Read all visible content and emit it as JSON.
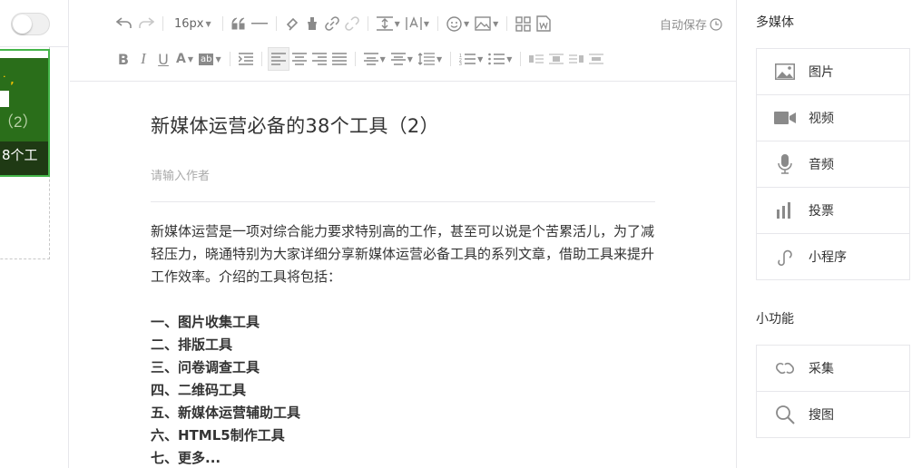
{
  "left": {
    "thumb_subtitle": "（2）",
    "thumb_caption": "8个工"
  },
  "toolbar": {
    "font_size": "16px",
    "autosave_label": "自动保存"
  },
  "editor": {
    "title": "新媒体运营必备的38个工具（2）",
    "author_placeholder": "请输入作者",
    "paragraph": "新媒体运营是一项对综合能力要求特别高的工作，甚至可以说是个苦累活儿，为了减轻压力，晓通特别为大家详细分享新媒体运营必备工具的系列文章，借助工具来提升工作效率。介绍的工具将包括：",
    "list": [
      "一、图片收集工具",
      "二、排版工具",
      "三、问卷调查工具",
      "四、二维码工具",
      "五、新媒体运营辅助工具",
      "六、HTML5制作工具",
      "七、更多..."
    ]
  },
  "sidebar": {
    "multimedia_title": "多媒体",
    "multimedia_items": [
      {
        "label": "图片",
        "icon": "image-icon"
      },
      {
        "label": "视频",
        "icon": "video-icon"
      },
      {
        "label": "音频",
        "icon": "microphone-icon"
      },
      {
        "label": "投票",
        "icon": "bar-chart-icon"
      },
      {
        "label": "小程序",
        "icon": "link-icon"
      }
    ],
    "tools_title": "小功能",
    "tools_items": [
      {
        "label": "采集",
        "icon": "collect-icon"
      },
      {
        "label": "搜图",
        "icon": "search-icon"
      }
    ]
  },
  "colors": {
    "accent_green": "#44b549",
    "icon_gray": "#8a8a8a",
    "border": "#e7e7eb"
  }
}
